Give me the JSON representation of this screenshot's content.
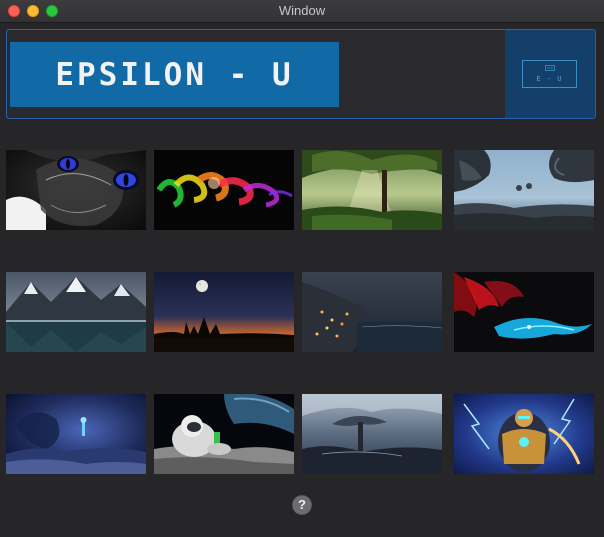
{
  "window": {
    "title": "Window"
  },
  "banner": {
    "logo_text": "EPSILON - U",
    "badge_text": "E - U"
  },
  "gallery": {
    "thumbnails": [
      {
        "name": "cat-neon-eyes-wallpaper"
      },
      {
        "name": "rainbow-smoke-wallpaper"
      },
      {
        "name": "sunlit-forest-tree-wallpaper"
      },
      {
        "name": "dragons-over-city-wallpaper"
      },
      {
        "name": "mountain-lake-wallpaper"
      },
      {
        "name": "moon-night-silhouette-wallpaper"
      },
      {
        "name": "coastal-town-night-wallpaper"
      },
      {
        "name": "red-blue-wolf-wallpaper"
      },
      {
        "name": "blue-fantasy-warrior-wallpaper"
      },
      {
        "name": "astronaut-on-moon-wallpaper"
      },
      {
        "name": "storm-tree-landscape-wallpaper"
      },
      {
        "name": "lightning-armored-hero-wallpaper"
      }
    ]
  },
  "help": {
    "label": "?"
  },
  "colors": {
    "accent_border": "#2a5fb0",
    "logo_background": "#1169a5",
    "badge_background": "#133f6a",
    "window_background": "#262629"
  }
}
